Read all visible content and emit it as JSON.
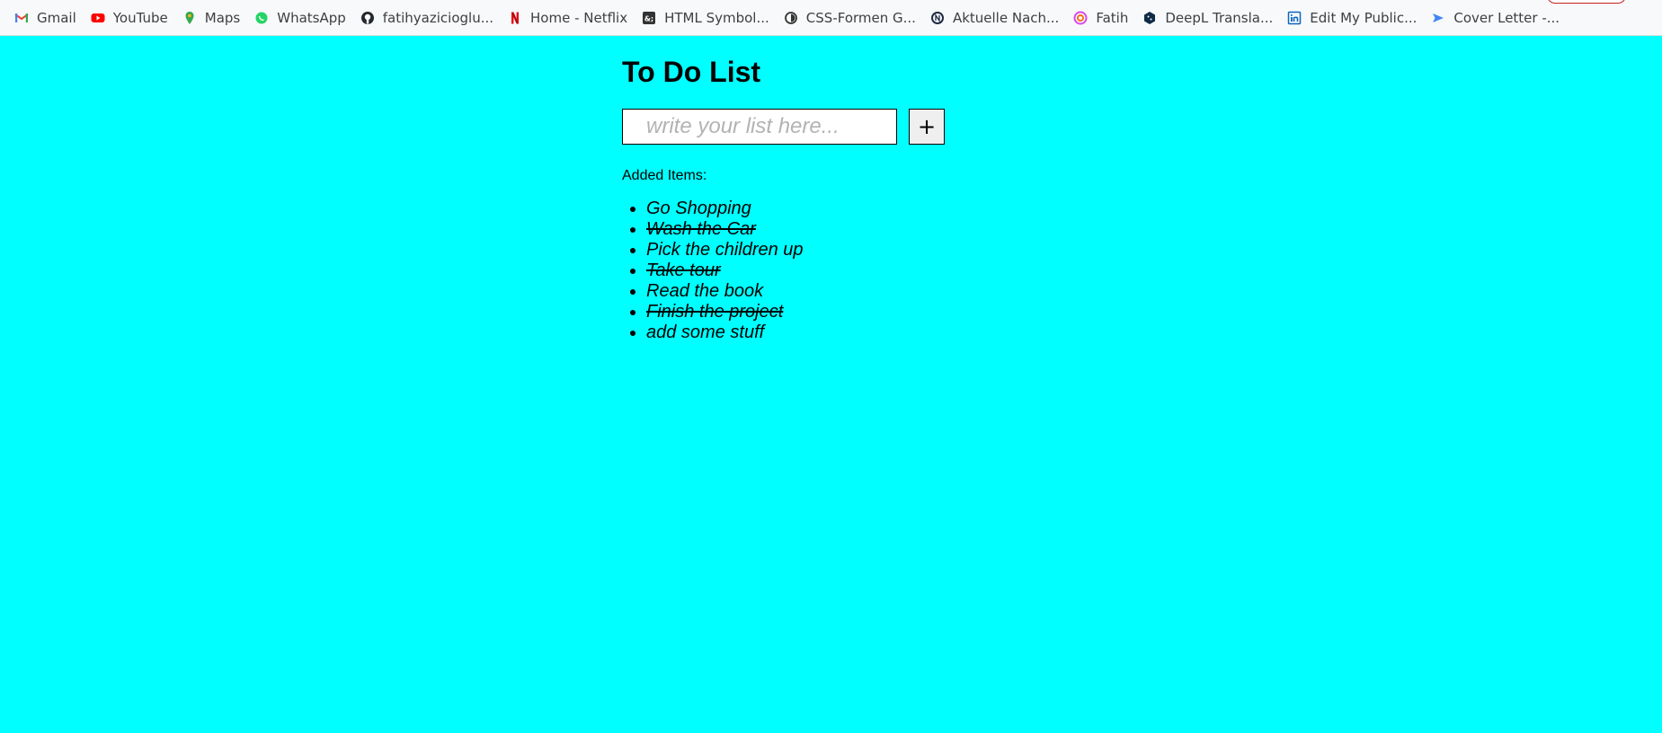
{
  "bookmarks": [
    {
      "label": "Gmail",
      "icon": "gmail-icon",
      "color": "#ea4335"
    },
    {
      "label": "YouTube",
      "icon": "youtube-icon",
      "color": "#ff0000"
    },
    {
      "label": "Maps",
      "icon": "maps-pin-icon",
      "color": "#34a853"
    },
    {
      "label": "WhatsApp",
      "icon": "whatsapp-icon",
      "color": "#25d366"
    },
    {
      "label": "fatihyazicioglu...",
      "icon": "github-icon",
      "color": "#24292e"
    },
    {
      "label": "Home - Netflix",
      "icon": "netflix-icon",
      "color": "#e50914"
    },
    {
      "label": "HTML Symbol...",
      "icon": "html-symbol-icon",
      "color": "#333333"
    },
    {
      "label": "CSS-Formen G...",
      "icon": "css-forms-icon",
      "color": "#333333"
    },
    {
      "label": "Aktuelle Nach...",
      "icon": "news-icon",
      "color": "#1f2a44"
    },
    {
      "label": "Fatih",
      "icon": "fatih-swirl-icon",
      "color": "#d946ef"
    },
    {
      "label": "DeepL Transla...",
      "icon": "deepl-icon",
      "color": "#0f2b46"
    },
    {
      "label": "Edit My Public...",
      "icon": "linkedin-icon",
      "color": "#0a66c2"
    },
    {
      "label": "Cover Letter -...",
      "icon": "cover-letter-icon",
      "color": "#4285f4"
    }
  ],
  "app": {
    "title": "To Do List",
    "input_placeholder": "write your list here...",
    "input_value": "",
    "add_button_label": "+",
    "added_label": "Added Items:",
    "items": [
      {
        "text": "Go Shopping",
        "done": false
      },
      {
        "text": "Wash the Car",
        "done": true
      },
      {
        "text": "Pick the children up",
        "done": false
      },
      {
        "text": "Take tour",
        "done": true
      },
      {
        "text": "Read the book",
        "done": false
      },
      {
        "text": "Finish the project",
        "done": true
      },
      {
        "text": "add some stuff",
        "done": false
      }
    ]
  },
  "colors": {
    "page_background": "#00ffff",
    "bookmarks_bar_background": "#f8f9fa"
  }
}
